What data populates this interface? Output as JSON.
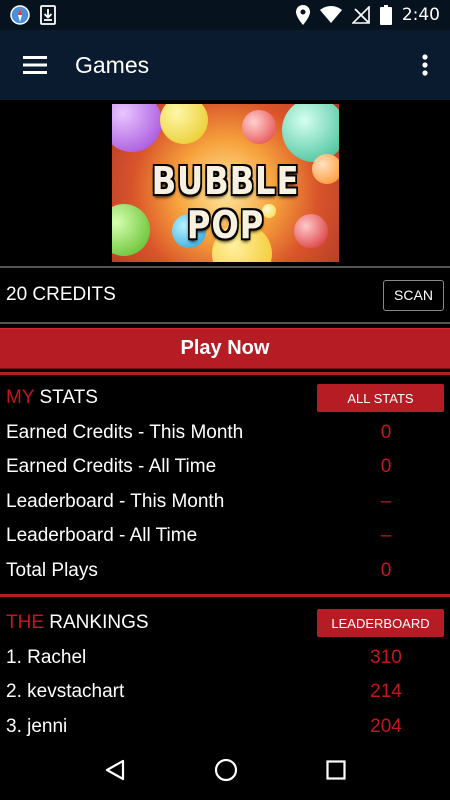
{
  "status_bar": {
    "time": "2:40",
    "icons": [
      "compass-icon",
      "download-icon",
      "location-icon",
      "wifi-icon",
      "no-signal-icon",
      "battery-icon"
    ]
  },
  "app_bar": {
    "title": "Games",
    "icons": [
      "menu-icon",
      "more-vert-icon"
    ]
  },
  "game": {
    "banner_title": "BUBBLE POP"
  },
  "credits": {
    "text": "20 CREDITS",
    "scan_label": "SCAN"
  },
  "play_now_label": "Play Now",
  "my_stats": {
    "title_accent": "MY",
    "title_rest": " STATS",
    "button_label": "ALL STATS",
    "rows": [
      {
        "label": "Earned Credits - This Month",
        "value": "0"
      },
      {
        "label": "Earned Credits - All Time",
        "value": "0"
      },
      {
        "label": "Leaderboard - This Month",
        "value": "–"
      },
      {
        "label": "Leaderboard - All Time",
        "value": "–"
      },
      {
        "label": "Total Plays",
        "value": "0"
      }
    ]
  },
  "rankings": {
    "title_accent": "THE",
    "title_rest": " RANKINGS",
    "button_label": "LEADERBOARD",
    "rows": [
      {
        "label": "1. Rachel",
        "value": "310"
      },
      {
        "label": "2. kevstachart",
        "value": "214"
      },
      {
        "label": "3. jenni",
        "value": "204"
      }
    ]
  },
  "nav_bar": {
    "icons": [
      "back-icon",
      "home-icon",
      "recents-icon"
    ]
  },
  "colors": {
    "accent_red": "#b51c23",
    "app_bar": "#0a1a2f",
    "status_bar": "#07121f"
  }
}
